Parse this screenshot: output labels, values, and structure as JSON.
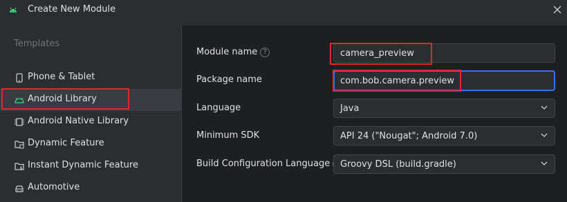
{
  "window": {
    "title": "Create New Module"
  },
  "sidebar": {
    "section_label": "Templates",
    "items": [
      {
        "label": "Phone & Tablet",
        "icon": "phone-icon"
      },
      {
        "label": "Android Library",
        "icon": "android-icon",
        "selected": true
      },
      {
        "label": "Android Native Library",
        "icon": "native-library-icon"
      },
      {
        "label": "Dynamic Feature",
        "icon": "folder-icon"
      },
      {
        "label": "Instant Dynamic Feature",
        "icon": "folder-icon"
      },
      {
        "label": "Automotive",
        "icon": "car-icon"
      }
    ]
  },
  "form": {
    "module_name": {
      "label": "Module name",
      "value": "camera_preview",
      "has_help": true
    },
    "package_name": {
      "label": "Package name",
      "value": "com.bob.camera.preview"
    },
    "language": {
      "label": "Language",
      "value": "Java"
    },
    "min_sdk": {
      "label": "Minimum SDK",
      "value": "API 24 (\"Nougat\"; Android 7.0)"
    },
    "build_config": {
      "label": "Build Configuration Language",
      "value": "Groovy DSL (build.gradle)",
      "has_help": true
    }
  },
  "colors": {
    "accent": "#3574f0",
    "highlight_box": "#e0262e",
    "android_green": "#3ddc84"
  }
}
